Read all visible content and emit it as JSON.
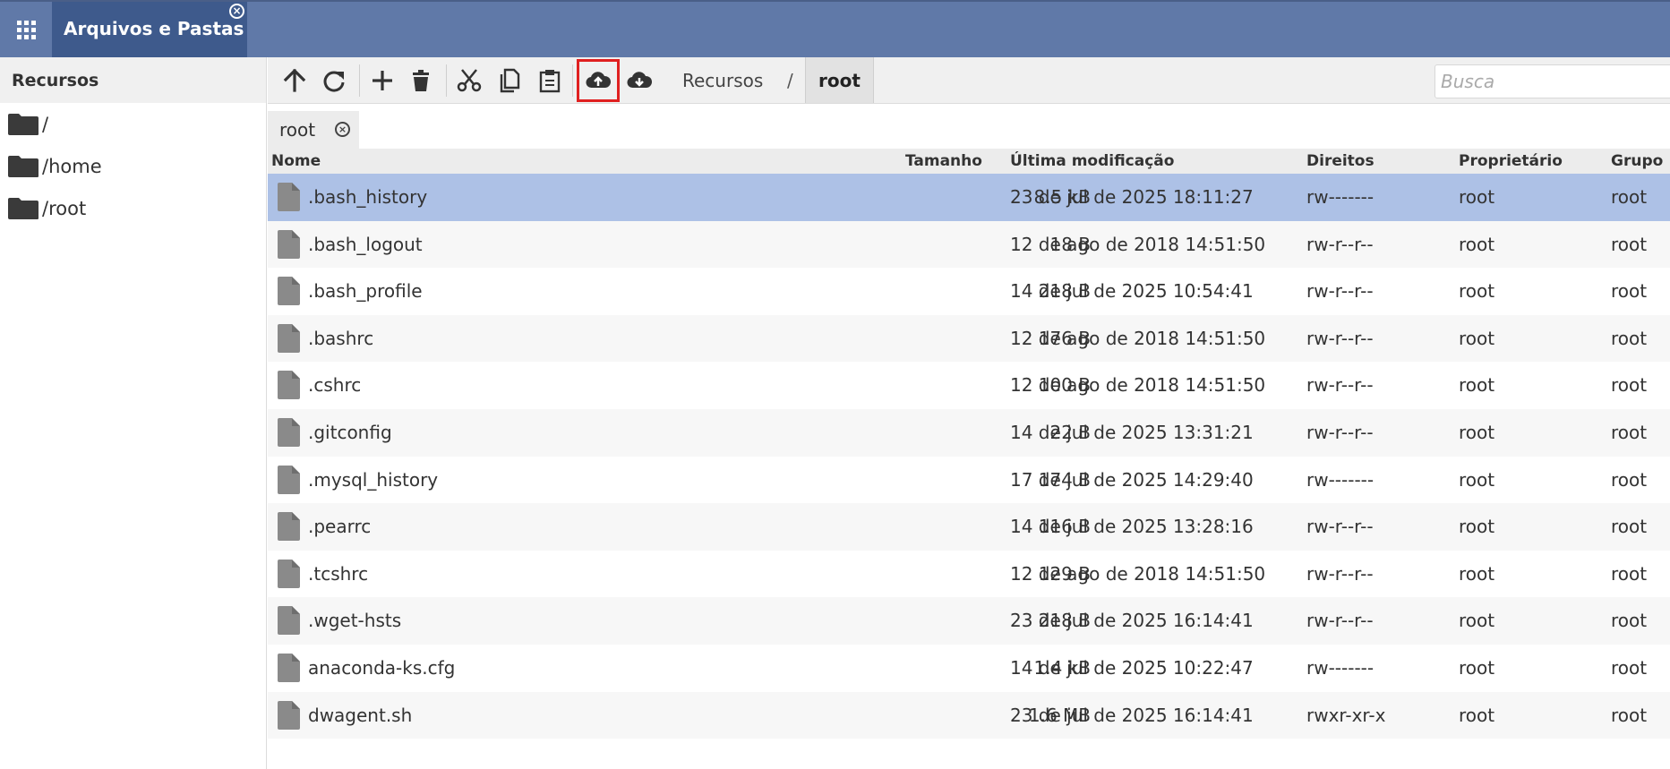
{
  "app": {
    "tab_title": "Arquivos e Pastas"
  },
  "sidebar": {
    "header": "Recursos",
    "items": [
      {
        "label": "/"
      },
      {
        "label": "/home"
      },
      {
        "label": "/root"
      }
    ]
  },
  "toolbar": {
    "buttons": [
      "arrow-up-icon",
      "refresh-icon",
      "plus-icon",
      "trash-icon",
      "cut-icon",
      "copy-icon",
      "paste-icon",
      "cloud-upload-icon",
      "cloud-download-icon"
    ],
    "breadcrumb": {
      "root": "Recursos",
      "separator": "/",
      "current": "root"
    },
    "search_placeholder": "Busca",
    "highlight_color": "#e02020"
  },
  "tabs": [
    {
      "label": "root"
    }
  ],
  "table": {
    "columns": {
      "name": "Nome",
      "size": "Tamanho",
      "modified": "Última modificação",
      "rights": "Direitos",
      "owner": "Proprietário",
      "group": "Grupo"
    },
    "rows": [
      {
        "name": ".bash_history",
        "size": "8.5 kB",
        "modified": "23 de jul de 2025 18:11:27",
        "rights": "rw-------",
        "owner": "root",
        "group": "root"
      },
      {
        "name": ".bash_logout",
        "size": "18 B",
        "modified": "12 de ago de 2018 14:51:50",
        "rights": "rw-r--r--",
        "owner": "root",
        "group": "root"
      },
      {
        "name": ".bash_profile",
        "size": "218 B",
        "modified": "14 de jul de 2025 10:54:41",
        "rights": "rw-r--r--",
        "owner": "root",
        "group": "root"
      },
      {
        "name": ".bashrc",
        "size": "176 B",
        "modified": "12 de ago de 2018 14:51:50",
        "rights": "rw-r--r--",
        "owner": "root",
        "group": "root"
      },
      {
        "name": ".cshrc",
        "size": "100 B",
        "modified": "12 de ago de 2018 14:51:50",
        "rights": "rw-r--r--",
        "owner": "root",
        "group": "root"
      },
      {
        "name": ".gitconfig",
        "size": "22 B",
        "modified": "14 de jul de 2025 13:31:21",
        "rights": "rw-r--r--",
        "owner": "root",
        "group": "root"
      },
      {
        "name": ".mysql_history",
        "size": "174 B",
        "modified": "17 de jul de 2025 14:29:40",
        "rights": "rw-------",
        "owner": "root",
        "group": "root"
      },
      {
        "name": ".pearrc",
        "size": "116 B",
        "modified": "14 de jul de 2025 13:28:16",
        "rights": "rw-r--r--",
        "owner": "root",
        "group": "root"
      },
      {
        "name": ".tcshrc",
        "size": "129 B",
        "modified": "12 de ago de 2018 14:51:50",
        "rights": "rw-r--r--",
        "owner": "root",
        "group": "root"
      },
      {
        "name": ".wget-hsts",
        "size": "218 B",
        "modified": "23 de jul de 2025 16:14:41",
        "rights": "rw-r--r--",
        "owner": "root",
        "group": "root"
      },
      {
        "name": "anaconda-ks.cfg",
        "size": "1.4 kB",
        "modified": "14 de jul de 2025 10:22:47",
        "rights": "rw-------",
        "owner": "root",
        "group": "root"
      },
      {
        "name": "dwagent.sh",
        "size": "1.6 MB",
        "modified": "23 de jul de 2025 16:14:41",
        "rights": "rwxr-xr-x",
        "owner": "root",
        "group": "root"
      }
    ]
  },
  "colors": {
    "topbar": "#6079a8",
    "active_tab": "#3e5a8c",
    "selected_row": "#adc1e6"
  }
}
